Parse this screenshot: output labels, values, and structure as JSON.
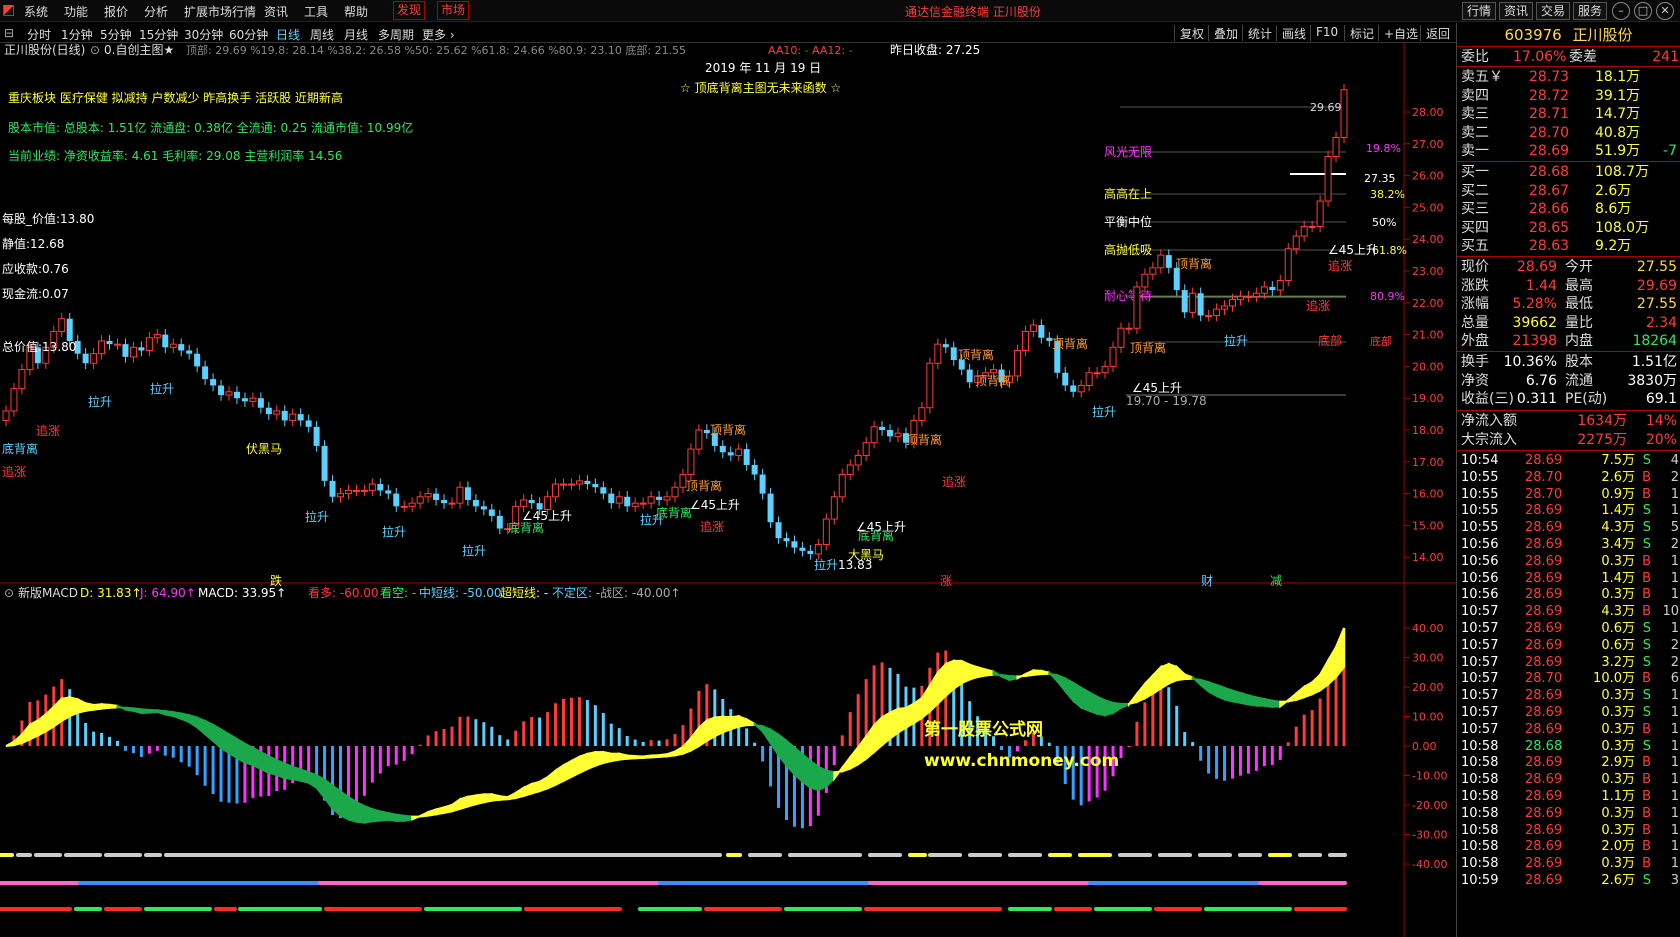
{
  "menu": {
    "items": [
      "系统",
      "功能",
      "报价",
      "分析",
      "扩展市场行情",
      "资讯",
      "工具",
      "帮助"
    ],
    "mode_buttons": [
      "发现",
      "市场"
    ],
    "app_title": "通达信金融终端  正川股份",
    "right_buttons": [
      "行情",
      "资讯",
      "交易",
      "服务"
    ]
  },
  "period_bar": {
    "periods": [
      "分时",
      "1分钟",
      "5分钟",
      "15分钟",
      "30分钟",
      "60分钟",
      "日线",
      "周线",
      "月线",
      "多周期",
      "更多 ›"
    ],
    "selected_period": "日线",
    "tools": [
      "复权",
      "叠加",
      "统计",
      "画线",
      "F10",
      "标记",
      "+自选",
      "返回"
    ]
  },
  "main_chart": {
    "header": {
      "title": "正川股份(日线)",
      "formula": "0.自创主图★",
      "levels": "顶部: 29.69 %19.8: 28.14 %38.2: 26.58 %50: 25.62 %61.8: 24.66 %80.9: 23.10 底部: 21.55",
      "aa": "AA10: - AA12: -",
      "prev_close": "昨日收盘: 27.25"
    },
    "date_label": "2019 年 11 月 19 日",
    "slogan": "☆ 顶底背离主图无未来函数 ☆",
    "info_lines": [
      "重庆板块  医疗保健  拟减持  户数减少  昨高换手  活跃股  近期新高",
      "股本市值: 总股本: 1.51亿 流通盘: 0.38亿 全流通: 0.25 流通市值: 10.99亿",
      "当前业绩:  净资收益率: 4.61 毛利率: 29.08 主营利润率 14.56"
    ],
    "fundamentals": [
      "每股_价值:13.80",
      "静值:12.68",
      "应收款:0.76",
      "现金流:0.07",
      "总价值:13.80"
    ],
    "y_ticks": [
      "28.00",
      "27.00",
      "26.00",
      "25.00",
      "24.00",
      "23.00",
      "22.00",
      "21.00",
      "20.00",
      "19.00",
      "18.00",
      "17.00",
      "16.00",
      "15.00",
      "14.00"
    ],
    "level_labels": [
      "风光无限",
      "高高在上",
      "平衡中位",
      "高抛低吸",
      "耐心等待"
    ],
    "level_values": [
      "29.69",
      "19.8%",
      "27.35",
      "38.2%",
      "50%",
      "61.8%",
      "80.9%",
      "底部"
    ],
    "annotations": [
      "追涨",
      "底背离",
      "追涨",
      "拉升",
      "拉升",
      "伏黑马",
      "拉升",
      "拉升",
      "拉升",
      "底背离",
      "∠45上升",
      "拉升",
      "顶背离",
      "顶背离",
      "∠45上升",
      "底背离",
      "追涨",
      "拉升",
      "13.83",
      "∠45上升",
      "底背离",
      "大黑马",
      "顶背离",
      "追涨",
      "顶背离",
      "顶背离",
      "顶背离",
      "∠45上升",
      "19.70 - 19.78",
      "拉升",
      "顶背离",
      "顶背离",
      "拉升",
      "∠45上升",
      "追涨",
      "追涨",
      "底部",
      "跌",
      "涨",
      "财",
      "减"
    ],
    "closes": [
      18.6,
      19.3,
      19.9,
      20.6,
      20.1,
      20.6,
      21.1,
      21.5,
      20.8,
      20.4,
      20.1,
      20.4,
      20.8,
      20.7,
      20.7,
      20.3,
      20.6,
      20.5,
      20.9,
      21.0,
      20.6,
      20.7,
      20.5,
      20.4,
      20.0,
      19.6,
      19.4,
      19.1,
      19.2,
      19.0,
      18.9,
      19.0,
      18.7,
      18.5,
      18.6,
      18.3,
      18.5,
      18.3,
      18.1,
      17.5,
      16.4,
      15.9,
      16.0,
      16.1,
      16.1,
      16.1,
      16.3,
      16.1,
      16.0,
      15.6,
      15.6,
      15.7,
      15.9,
      16.0,
      15.8,
      15.7,
      15.7,
      16.2,
      15.8,
      15.6,
      15.5,
      15.3,
      14.9,
      14.9,
      15.6,
      15.8,
      15.7,
      15.5,
      15.9,
      16.3,
      16.3,
      16.3,
      16.4,
      16.3,
      16.2,
      16.0,
      15.7,
      15.9,
      15.6,
      15.7,
      15.7,
      15.9,
      15.8,
      15.9,
      16.2,
      16.6,
      17.4,
      18.0,
      17.9,
      17.5,
      17.3,
      17.2,
      17.4,
      16.9,
      16.6,
      16.0,
      15.1,
      14.6,
      14.5,
      14.3,
      14.2,
      14.1,
      14.4,
      15.2,
      15.9,
      16.6,
      16.9,
      17.2,
      17.6,
      18.1,
      18.0,
      17.8,
      17.9,
      17.6,
      18.3,
      18.7,
      20.1,
      20.7,
      20.6,
      20.2,
      19.9,
      19.5,
      19.7,
      19.8,
      19.9,
      19.5,
      19.7,
      20.5,
      21.1,
      21.3,
      20.9,
      20.8,
      19.8,
      19.4,
      19.2,
      19.4,
      19.8,
      19.8,
      20.0,
      20.6,
      21.2,
      21.2,
      22.5,
      22.9,
      23.1,
      23.5,
      23.1,
      22.4,
      21.7,
      22.3,
      21.6,
      21.6,
      21.8,
      21.9,
      22.1,
      22.2,
      22.2,
      22.3,
      22.5,
      22.4,
      22.7,
      23.7,
      24.1,
      24.4,
      24.4,
      25.2,
      26.6,
      27.2,
      28.7
    ],
    "bottom_markers": [
      "跌",
      "涨",
      "财",
      "减"
    ]
  },
  "macd_panel": {
    "header": {
      "name": "新版MACD",
      "d": "D: 31.83↑",
      "j": "J: 64.90↑",
      "macd": "MACD: 33.95↑",
      "kan_duo": "看多: -60.00",
      "kan_kong": "看空: -",
      "zhong_duan": "中短线: -50.00",
      "chao_duan": "超短线: -",
      "bu_ding": "不定区: -",
      "zhan_qu": "战区: -40.00↑"
    },
    "y_ticks": [
      "40.00",
      "30.00",
      "20.00",
      "10.00",
      "0.00",
      "-10.00",
      "-20.00",
      "-30.00",
      "-40.00"
    ],
    "watermark": [
      "第一股票公式网",
      "www.chnmoney.com"
    ]
  },
  "quote_panel": {
    "code": "603976",
    "name": "正川股份",
    "wei_bi": {
      "label": "委比",
      "value": "17.06%",
      "label2": "委差",
      "value2": "241"
    },
    "asks": [
      {
        "label": "卖五￥",
        "price": "28.73",
        "vol": "18.1万",
        "chg": ""
      },
      {
        "label": "卖四",
        "price": "28.72",
        "vol": "39.1万",
        "chg": ""
      },
      {
        "label": "卖三",
        "price": "28.71",
        "vol": "14.7万",
        "chg": ""
      },
      {
        "label": "卖二",
        "price": "28.70",
        "vol": "40.8万",
        "chg": ""
      },
      {
        "label": "卖一",
        "price": "28.69",
        "vol": "51.9万",
        "chg": "-7"
      }
    ],
    "bids": [
      {
        "label": "买一",
        "price": "28.68",
        "vol": "108.7万"
      },
      {
        "label": "买二",
        "price": "28.67",
        "vol": "2.6万"
      },
      {
        "label": "买三",
        "price": "28.66",
        "vol": "8.6万"
      },
      {
        "label": "买四",
        "price": "28.65",
        "vol": "108.0万"
      },
      {
        "label": "买五",
        "price": "28.63",
        "vol": "9.2万"
      }
    ],
    "stats": [
      {
        "l1": "现价",
        "v1": "28.69",
        "l2": "今开",
        "v2": "27.55"
      },
      {
        "l1": "涨跌",
        "v1": "1.44",
        "l2": "最高",
        "v2": "29.69"
      },
      {
        "l1": "涨幅",
        "v1": "5.28%",
        "l2": "最低",
        "v2": "27.55"
      },
      {
        "l1": "总量",
        "v1": "39662",
        "l2": "量比",
        "v2": "2.34"
      },
      {
        "l1": "外盘",
        "v1": "21398",
        "l2": "内盘",
        "v2": "18264"
      }
    ],
    "stats2": [
      {
        "l1": "换手",
        "v1": "10.36%",
        "l2": "股本",
        "v2": "1.51亿"
      },
      {
        "l1": "净资",
        "v1": "6.76",
        "l2": "流通",
        "v2": "3830万"
      },
      {
        "l1": "收益(三)",
        "v1": "0.311",
        "l2": "PE(动)",
        "v2": "69.1"
      }
    ],
    "flows": [
      {
        "label": "净流入额",
        "value": "1634万",
        "pct": "14%"
      },
      {
        "label": "大宗流入",
        "value": "2275万",
        "pct": "20%"
      }
    ],
    "ticks": [
      {
        "t": "10:54",
        "p": "28.69",
        "v": "7.5万",
        "s": "S",
        "n": "4"
      },
      {
        "t": "10:55",
        "p": "28.70",
        "v": "2.6万",
        "s": "B",
        "n": "2"
      },
      {
        "t": "10:55",
        "p": "28.70",
        "v": "0.9万",
        "s": "B",
        "n": "1"
      },
      {
        "t": "10:55",
        "p": "28.69",
        "v": "1.4万",
        "s": "S",
        "n": "1"
      },
      {
        "t": "10:55",
        "p": "28.69",
        "v": "4.3万",
        "s": "S",
        "n": "5"
      },
      {
        "t": "10:56",
        "p": "28.69",
        "v": "3.4万",
        "s": "S",
        "n": "2"
      },
      {
        "t": "10:56",
        "p": "28.69",
        "v": "0.3万",
        "s": "B",
        "n": "1"
      },
      {
        "t": "10:56",
        "p": "28.69",
        "v": "1.4万",
        "s": "B",
        "n": "1"
      },
      {
        "t": "10:56",
        "p": "28.69",
        "v": "0.3万",
        "s": "B",
        "n": "1"
      },
      {
        "t": "10:57",
        "p": "28.69",
        "v": "4.3万",
        "s": "B",
        "n": "10"
      },
      {
        "t": "10:57",
        "p": "28.69",
        "v": "0.6万",
        "s": "S",
        "n": "1"
      },
      {
        "t": "10:57",
        "p": "28.69",
        "v": "0.6万",
        "s": "S",
        "n": "2"
      },
      {
        "t": "10:57",
        "p": "28.69",
        "v": "3.2万",
        "s": "S",
        "n": "2"
      },
      {
        "t": "10:57",
        "p": "28.70",
        "v": "10.0万",
        "s": "B",
        "n": "6"
      },
      {
        "t": "10:57",
        "p": "28.69",
        "v": "0.3万",
        "s": "S",
        "n": "1"
      },
      {
        "t": "10:57",
        "p": "28.69",
        "v": "0.3万",
        "s": "S",
        "n": "1"
      },
      {
        "t": "10:57",
        "p": "28.69",
        "v": "0.3万",
        "s": "B",
        "n": "1"
      },
      {
        "t": "10:58",
        "p": "28.68",
        "v": "0.3万",
        "s": "S",
        "n": "1"
      },
      {
        "t": "10:58",
        "p": "28.69",
        "v": "2.9万",
        "s": "B",
        "n": "1"
      },
      {
        "t": "10:58",
        "p": "28.69",
        "v": "0.3万",
        "s": "B",
        "n": "1"
      },
      {
        "t": "10:58",
        "p": "28.69",
        "v": "1.1万",
        "s": "B",
        "n": "1"
      },
      {
        "t": "10:58",
        "p": "28.69",
        "v": "0.3万",
        "s": "B",
        "n": "1"
      },
      {
        "t": "10:58",
        "p": "28.69",
        "v": "0.3万",
        "s": "B",
        "n": "1"
      },
      {
        "t": "10:58",
        "p": "28.69",
        "v": "2.0万",
        "s": "B",
        "n": "1"
      },
      {
        "t": "10:58",
        "p": "28.69",
        "v": "0.3万",
        "s": "B",
        "n": "1"
      },
      {
        "t": "10:59",
        "p": "28.69",
        "v": "2.6万",
        "s": "S",
        "n": "3"
      }
    ]
  },
  "colors": {
    "up": "#ff3b3b",
    "down": "#5ad1ff",
    "yellow": "#ffff33",
    "green": "#1aa84a",
    "magenta": "#ff33ff",
    "accent": "#ffd84a"
  }
}
